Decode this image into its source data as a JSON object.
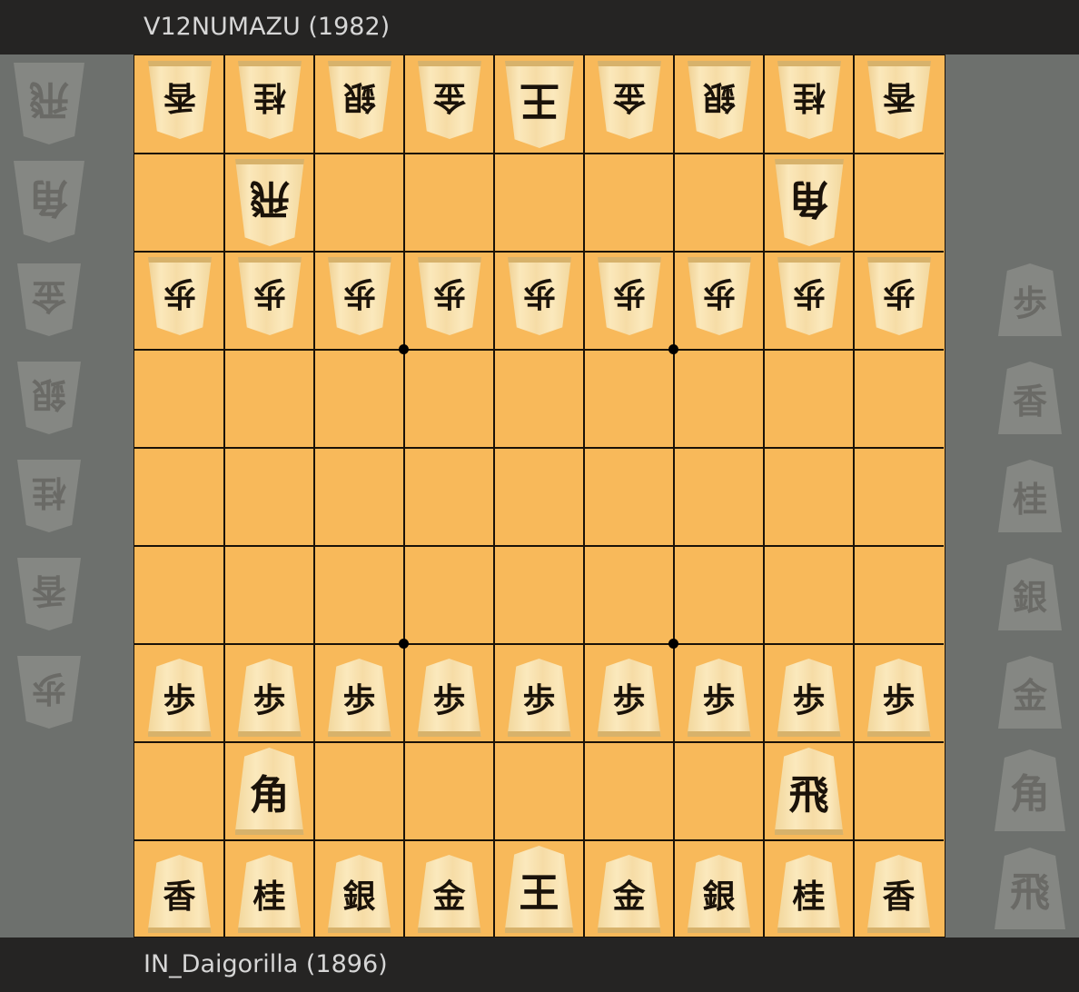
{
  "players": {
    "top": "V12NUMAZU (1982)",
    "bottom": "IN_Daigorilla (1896)"
  },
  "colors": {
    "board": "#f8b95a",
    "background": "#6d706d",
    "bar": "#252423",
    "grid": "#1a1208"
  },
  "board": [
    [
      "香v",
      "桂v",
      "銀v",
      "金v",
      "王v",
      "金v",
      "銀v",
      "桂v",
      "香v"
    ],
    [
      "",
      "飛v",
      "",
      "",
      "",
      "",
      "",
      "角v",
      ""
    ],
    [
      "歩v",
      "歩v",
      "歩v",
      "歩v",
      "歩v",
      "歩v",
      "歩v",
      "歩v",
      "歩v"
    ],
    [
      "",
      "",
      "",
      "",
      "",
      "",
      "",
      "",
      ""
    ],
    [
      "",
      "",
      "",
      "",
      "",
      "",
      "",
      "",
      ""
    ],
    [
      "",
      "",
      "",
      "",
      "",
      "",
      "",
      "",
      ""
    ],
    [
      "歩",
      "歩",
      "歩",
      "歩",
      "歩",
      "歩",
      "歩",
      "歩",
      "歩"
    ],
    [
      "",
      "角",
      "",
      "",
      "",
      "",
      "",
      "飛",
      ""
    ],
    [
      "香",
      "桂",
      "銀",
      "金",
      "王",
      "金",
      "銀",
      "桂",
      "香"
    ]
  ],
  "hands": {
    "gote": [
      "飛",
      "角",
      "金",
      "銀",
      "桂",
      "香",
      "歩"
    ],
    "sente": [
      "歩",
      "香",
      "桂",
      "銀",
      "金",
      "角",
      "飛"
    ]
  }
}
